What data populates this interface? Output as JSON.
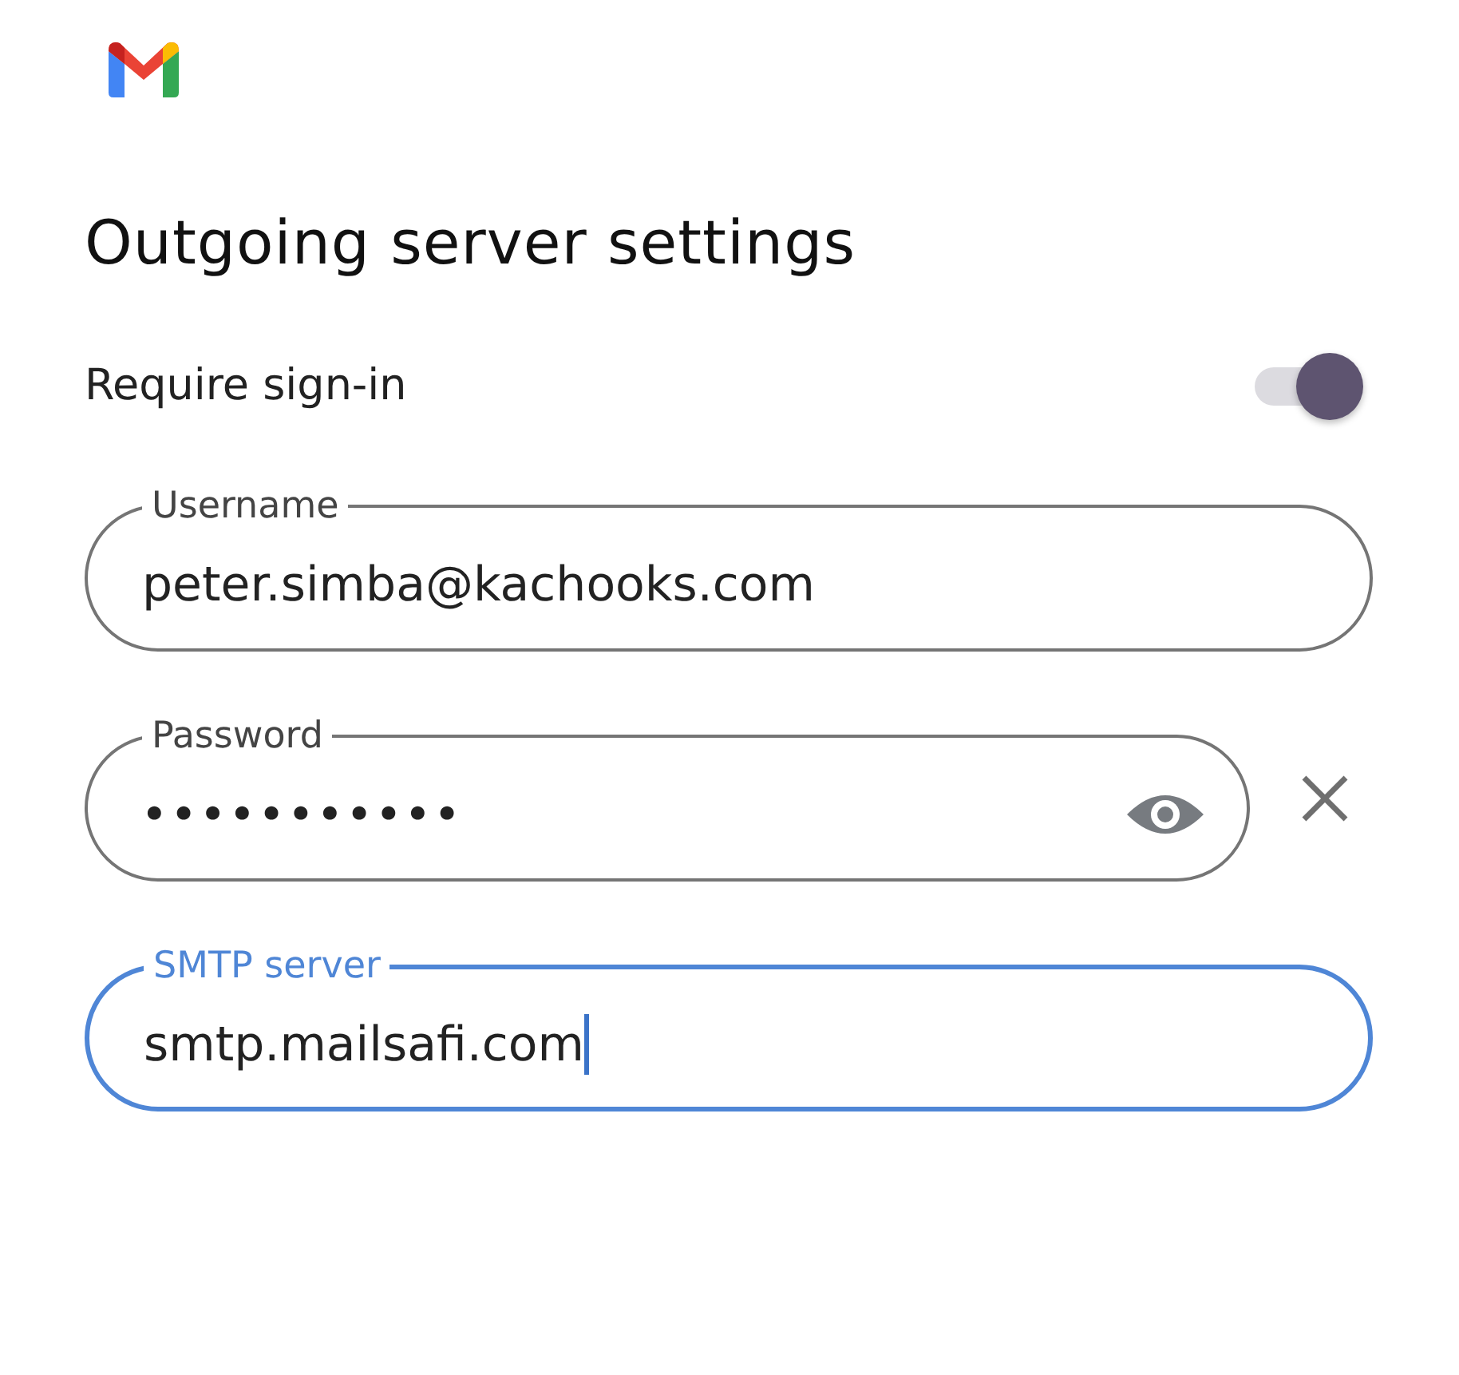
{
  "title": "Outgoing server settings",
  "require_sign_in": {
    "label": "Require sign-in",
    "on": true
  },
  "fields": [
    {
      "label": "Username",
      "value": "peter.simba@kachooks.com",
      "focused": false,
      "kind": "text"
    },
    {
      "label": "Password",
      "value": "•••••••••••",
      "focused": false,
      "kind": "password"
    },
    {
      "label": "SMTP server",
      "value": "smtp.mailsafi.com",
      "focused": true,
      "kind": "text"
    }
  ]
}
